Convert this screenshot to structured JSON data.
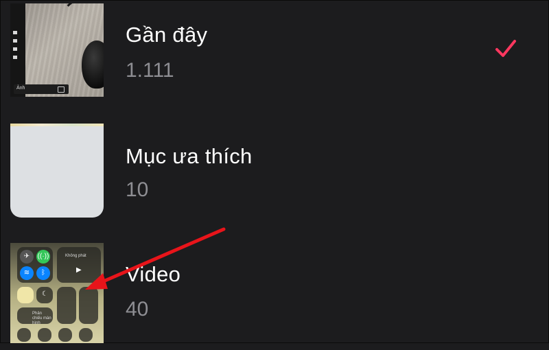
{
  "albums": [
    {
      "title": "Gần đây",
      "count": "1.111",
      "selected": true,
      "thumb_caption": "Ảnh"
    },
    {
      "title": "Mục ưa thích",
      "count": "10",
      "selected": false
    },
    {
      "title": "Video",
      "count": "40",
      "selected": false,
      "thumb_labels": {
        "now_playing": "Không phát",
        "screen_mirroring": "Phản chiếu màn hình"
      }
    }
  ],
  "icons": {
    "checkmark": "checkmark-icon",
    "annotation": "red-arrow-annotation"
  },
  "colors": {
    "background": "#1c1c1e",
    "title": "#ffffff",
    "count": "#8e8e93",
    "check": "#ff375f",
    "arrow": "#e8141a"
  }
}
